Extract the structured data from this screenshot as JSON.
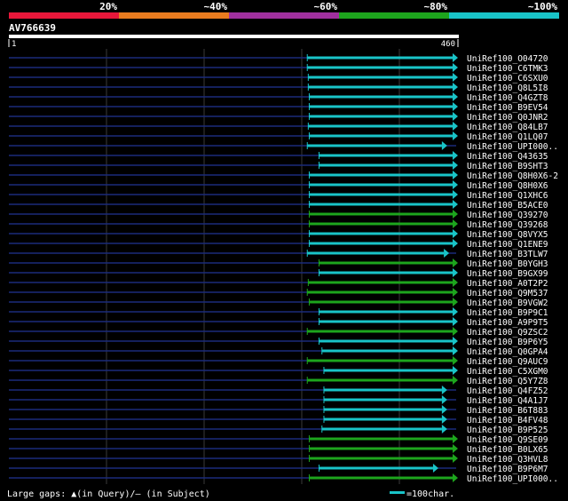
{
  "legend": {
    "scale": [
      {
        "label": "20%",
        "color": "#e8173a"
      },
      {
        "label": "~40%",
        "color": "#ea7c1f"
      },
      {
        "label": "~60%",
        "color": "#a0309e"
      },
      {
        "label": "~80%",
        "color": "#1da51d"
      },
      {
        "label": "~100%",
        "color": "#19c4c8"
      }
    ]
  },
  "query": {
    "id": "AV766639",
    "start_label": "1",
    "end_label": "460",
    "length": 460
  },
  "colors": {
    "query_line": "#1a2a7a",
    "grid": "#3a3a3a",
    "cyan": "#19c4c8",
    "green": "#1da51d",
    "background": "#000000"
  },
  "hits": [
    {
      "name": "UniRef100_O04720",
      "start": 306,
      "end": 460,
      "color": "cyan"
    },
    {
      "name": "UniRef100_C6TMK3",
      "start": 306,
      "end": 460,
      "color": "cyan"
    },
    {
      "name": "UniRef100_C6SXU0",
      "start": 307,
      "end": 460,
      "color": "cyan"
    },
    {
      "name": "UniRef100_Q8L5I8",
      "start": 307,
      "end": 460,
      "color": "cyan"
    },
    {
      "name": "UniRef100_Q4GZT8",
      "start": 308,
      "end": 460,
      "color": "cyan"
    },
    {
      "name": "UniRef100_B9EV54",
      "start": 308,
      "end": 460,
      "color": "cyan"
    },
    {
      "name": "UniRef100_Q0JNR2",
      "start": 308,
      "end": 460,
      "color": "cyan"
    },
    {
      "name": "UniRef100_Q84LB7",
      "start": 307,
      "end": 460,
      "color": "cyan"
    },
    {
      "name": "UniRef100_Q1LQ07",
      "start": 308,
      "end": 460,
      "color": "cyan"
    },
    {
      "name": "UniRef100_UPI000..",
      "start": 306,
      "end": 449,
      "color": "cyan"
    },
    {
      "name": "UniRef100_Q43635",
      "start": 318,
      "end": 460,
      "color": "cyan"
    },
    {
      "name": "UniRef100_B9SHT3",
      "start": 318,
      "end": 460,
      "color": "cyan"
    },
    {
      "name": "UniRef100_Q8H0X6-2",
      "start": 308,
      "end": 460,
      "color": "cyan"
    },
    {
      "name": "UniRef100_Q8H0X6",
      "start": 308,
      "end": 460,
      "color": "cyan"
    },
    {
      "name": "UniRef100_Q1XHC6",
      "start": 308,
      "end": 460,
      "color": "cyan"
    },
    {
      "name": "UniRef100_B5ACE0",
      "start": 308,
      "end": 460,
      "color": "cyan"
    },
    {
      "name": "UniRef100_Q39270",
      "start": 308,
      "end": 460,
      "color": "green"
    },
    {
      "name": "UniRef100_Q39268",
      "start": 308,
      "end": 460,
      "color": "green"
    },
    {
      "name": "UniRef100_Q8VYX5",
      "start": 308,
      "end": 460,
      "color": "cyan"
    },
    {
      "name": "UniRef100_Q1ENE9",
      "start": 308,
      "end": 460,
      "color": "cyan"
    },
    {
      "name": "UniRef100_B3TLW7",
      "start": 306,
      "end": 451,
      "color": "cyan"
    },
    {
      "name": "UniRef100_B0YGH3",
      "start": 318,
      "end": 460,
      "color": "green"
    },
    {
      "name": "UniRef100_B9GX99",
      "start": 318,
      "end": 460,
      "color": "cyan"
    },
    {
      "name": "UniRef100_A0T2P2",
      "start": 307,
      "end": 460,
      "color": "green"
    },
    {
      "name": "UniRef100_Q9M537",
      "start": 306,
      "end": 460,
      "color": "green"
    },
    {
      "name": "UniRef100_B9VGW2",
      "start": 308,
      "end": 460,
      "color": "green"
    },
    {
      "name": "UniRef100_B9P9C1",
      "start": 318,
      "end": 460,
      "color": "cyan"
    },
    {
      "name": "UniRef100_A9P9T5",
      "start": 318,
      "end": 460,
      "color": "cyan"
    },
    {
      "name": "UniRef100_Q9ZSC2",
      "start": 306,
      "end": 460,
      "color": "green"
    },
    {
      "name": "UniRef100_B9P6Y5",
      "start": 318,
      "end": 460,
      "color": "cyan"
    },
    {
      "name": "UniRef100_Q0GPA4",
      "start": 321,
      "end": 460,
      "color": "cyan"
    },
    {
      "name": "UniRef100_Q9AUC9",
      "start": 306,
      "end": 460,
      "color": "green"
    },
    {
      "name": "UniRef100_C5XGM0",
      "start": 323,
      "end": 460,
      "color": "cyan"
    },
    {
      "name": "UniRef100_Q5Y7Z8",
      "start": 306,
      "end": 460,
      "color": "green"
    },
    {
      "name": "UniRef100_Q4FZ52",
      "start": 323,
      "end": 449,
      "color": "cyan"
    },
    {
      "name": "UniRef100_Q4A1J7",
      "start": 323,
      "end": 449,
      "color": "cyan"
    },
    {
      "name": "UniRef100_B6T883",
      "start": 323,
      "end": 449,
      "color": "cyan"
    },
    {
      "name": "UniRef100_B4FV48",
      "start": 323,
      "end": 449,
      "color": "cyan"
    },
    {
      "name": "UniRef100_B9P525",
      "start": 321,
      "end": 449,
      "color": "cyan"
    },
    {
      "name": "UniRef100_Q9SE09",
      "start": 308,
      "end": 460,
      "color": "green"
    },
    {
      "name": "UniRef100_B0LX65",
      "start": 308,
      "end": 460,
      "color": "green"
    },
    {
      "name": "UniRef100_Q3HVL8",
      "start": 308,
      "end": 460,
      "color": "green"
    },
    {
      "name": "UniRef100_B9P6M7",
      "start": 318,
      "end": 440,
      "color": "cyan"
    },
    {
      "name": "UniRef100_UPI000..",
      "start": 308,
      "end": 460,
      "color": "green"
    }
  ],
  "footer": {
    "gaps_label": "Large gaps: ▲(in Query)/– (in Subject)",
    "scale_label": "=100char."
  }
}
